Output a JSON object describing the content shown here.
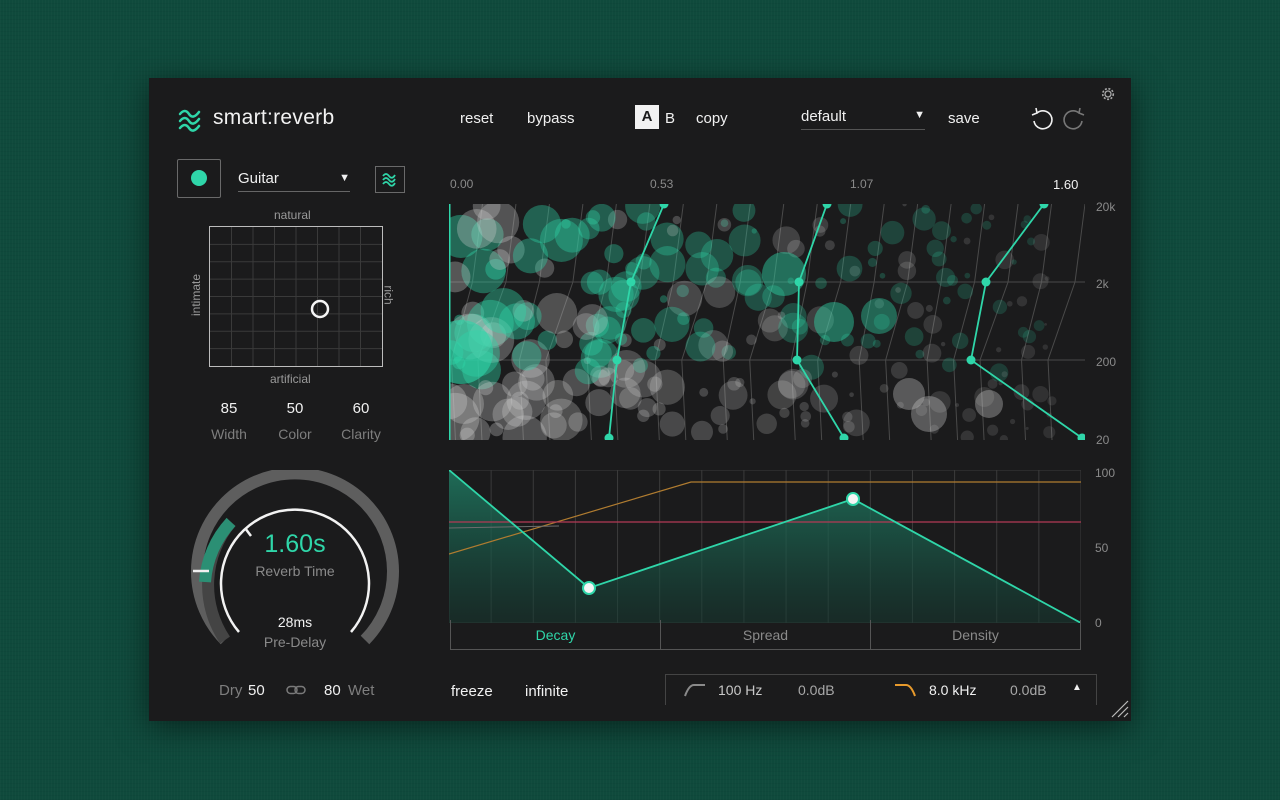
{
  "header": {
    "title": "smart:reverb",
    "reset_label": "reset",
    "bypass_label": "bypass",
    "ab_a_label": "A",
    "ab_b_label": "B",
    "copy_label": "copy",
    "preset_value": "default",
    "save_label": "save"
  },
  "left": {
    "profile_value": "Guitar",
    "xy": {
      "top": "natural",
      "bottom": "artificial",
      "left": "intimate",
      "right": "rich"
    },
    "params": [
      {
        "value": "85",
        "label": "Width"
      },
      {
        "value": "50",
        "label": "Color"
      },
      {
        "value": "60",
        "label": "Clarity"
      }
    ],
    "knob": {
      "value": "1.60s",
      "label": "Reverb Time",
      "predelay_value": "28ms",
      "predelay_label": "Pre-Delay"
    },
    "mix": {
      "dry_label": "Dry",
      "dry_value": "50",
      "wet_value": "80",
      "wet_label": "Wet"
    }
  },
  "top_graph": {
    "time_ticks": [
      "0.00",
      "0.53",
      "1.07",
      "1.60"
    ],
    "freq_ticks": [
      "20k",
      "2k",
      "200",
      "20"
    ]
  },
  "bottom_graph": {
    "y_ticks": [
      "100",
      "50",
      "0"
    ],
    "tabs": [
      "Decay",
      "Spread",
      "Density"
    ]
  },
  "footer": {
    "freeze_label": "freeze",
    "infinite_label": "infinite",
    "lowcut_freq": "100 Hz",
    "lowcut_gain": "0.0dB",
    "highcut_freq": "8.0 kHz",
    "highcut_gain": "0.0dB"
  },
  "colors": {
    "accent": "#2fd6a9",
    "background": "#1b1b1c",
    "highcut": "#e89a2c",
    "pink_line": "#c0405a"
  }
}
